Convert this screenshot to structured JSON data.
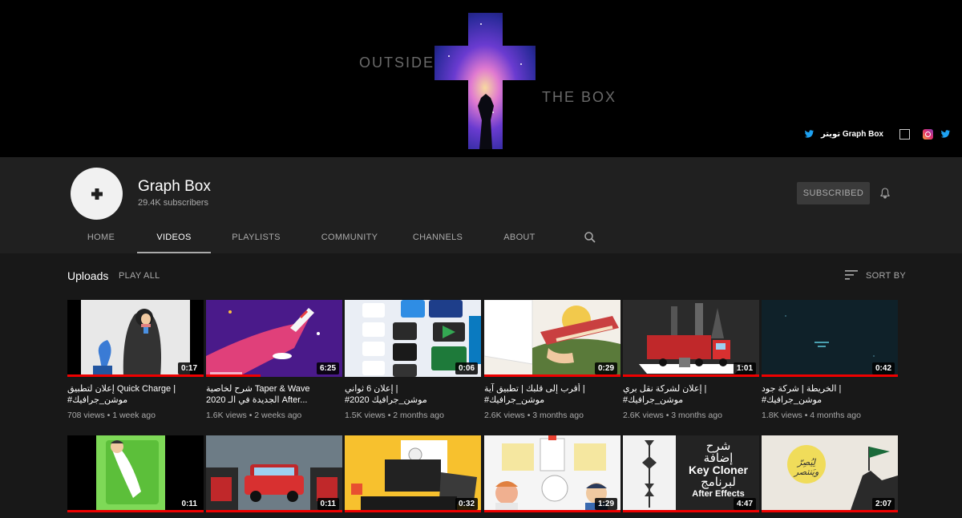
{
  "banner": {
    "word_left": "OUTSIDE",
    "word_right": "THE BOX",
    "link_label": "تويتر Graph Box"
  },
  "channel": {
    "name": "Graph Box",
    "subscribers": "29.4K subscribers",
    "subscribe_label": "SUBSCRIBED"
  },
  "tabs": [
    {
      "label": "HOME"
    },
    {
      "label": "VIDEOS"
    },
    {
      "label": "PLAYLISTS"
    },
    {
      "label": "COMMUNITY"
    },
    {
      "label": "CHANNELS"
    },
    {
      "label": "ABOUT"
    }
  ],
  "uploads": {
    "title": "Uploads",
    "play_all": "PLAY ALL",
    "sort_label": "SORT BY"
  },
  "videos": [
    {
      "duration": "0:17",
      "progress": 1.0,
      "title_line1": "إعلان لتطبيق Quick Charge |",
      "title_line2": "#موشن_جرافيك",
      "views": "708 views",
      "age": "1 week ago"
    },
    {
      "duration": "6:25",
      "progress": 0.4,
      "title_line1": "شرح لخاصية Taper & Wave",
      "title_line2": "الجديدة في الـ 2020 After...",
      "views": "1.6K views",
      "age": "2 weeks ago"
    },
    {
      "duration": "0:06",
      "progress": 0.0,
      "title_line1": "إعلان 6 ثواني |",
      "title_line2": "#موشن_جرافيك 2020",
      "views": "1.5K views",
      "age": "2 months ago"
    },
    {
      "duration": "0:29",
      "progress": 1.0,
      "title_line1": "أقرب إلى قلبك | تطبيق آية |",
      "title_line2": "#موشن_جرافيك",
      "views": "2.6K views",
      "age": "3 months ago"
    },
    {
      "duration": "1:01",
      "progress": 1.0,
      "title_line1": "إعلان لشركة نقل بري |",
      "title_line2": "#موشن_جرافيك",
      "views": "2.6K views",
      "age": "3 months ago"
    },
    {
      "duration": "0:42",
      "progress": 1.0,
      "title_line1": "الخريطة | شركة جود |",
      "title_line2": "#موشن_جرافيك",
      "views": "1.8K views",
      "age": "4 months ago"
    },
    {
      "duration": "0:11",
      "progress": 1.0
    },
    {
      "duration": "0:11",
      "progress": 1.0
    },
    {
      "duration": "0:32",
      "progress": 1.0
    },
    {
      "duration": "1:29",
      "progress": 1.0
    },
    {
      "duration": "4:47",
      "progress": 1.0,
      "thumb_text1": "شرح",
      "thumb_text2": "إضافة",
      "thumb_text3": "Key Cloner",
      "thumb_text4": "لبرنامج",
      "thumb_text5": "After Effects"
    },
    {
      "duration": "2:07",
      "progress": 1.0,
      "thumb_text1": "لِيُصِرّ",
      "thumb_text2": "ويَنتصر"
    }
  ]
}
